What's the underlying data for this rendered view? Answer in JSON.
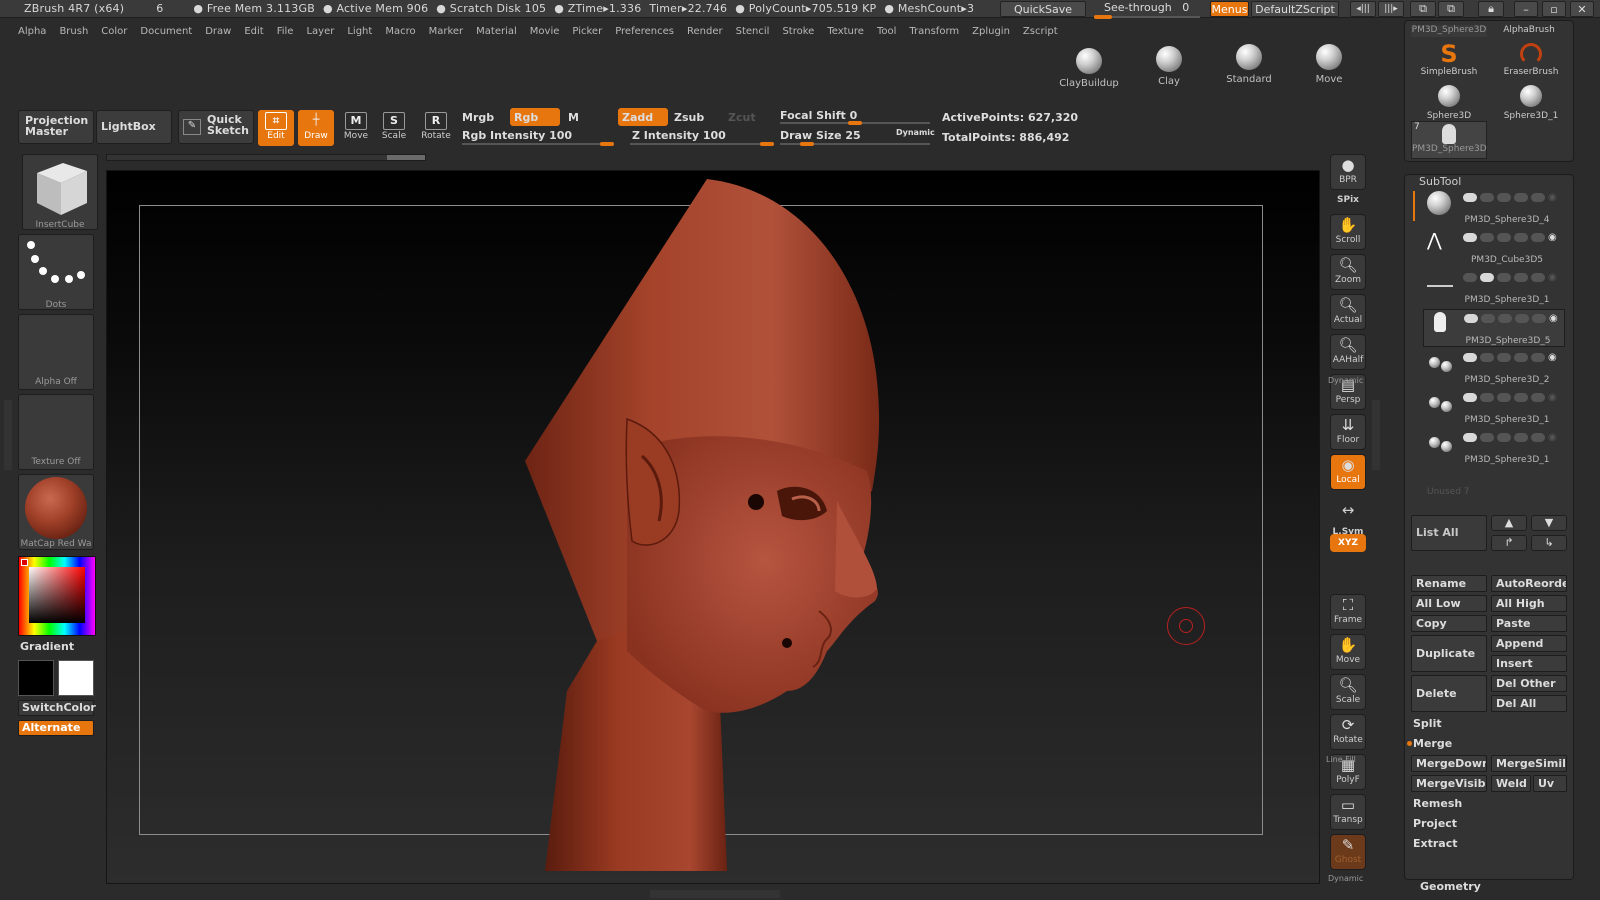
{
  "titlebar": {
    "app": "ZBrush 4R7 (x64)",
    "num": "6",
    "free_mem": "Free Mem 3.113GB",
    "active_mem": "Active Mem 906",
    "scratch": "Scratch Disk 105",
    "ztime": "ZTime▸1.336",
    "timer": "Timer▸22.746",
    "polycount": "PolyCount▸705.519 KP",
    "meshcount": "MeshCount▸3",
    "quicksave": "QuickSave",
    "seethrough": "See-through",
    "seethrough_val": "0",
    "menus": "Menus",
    "script": "DefaultZScript"
  },
  "menu": [
    "Alpha",
    "Brush",
    "Color",
    "Document",
    "Draw",
    "Edit",
    "File",
    "Layer",
    "Light",
    "Macro",
    "Marker",
    "Material",
    "Movie",
    "Picker",
    "Preferences",
    "Render",
    "Stencil",
    "Stroke",
    "Texture",
    "Tool",
    "Transform",
    "Zplugin",
    "Zscript"
  ],
  "brushes": [
    "ClayBuildup",
    "Clay",
    "Standard",
    "Move"
  ],
  "toolbar": {
    "projection_master": "Projection Master",
    "lightbox": "LightBox",
    "quick_sketch": "Quick Sketch",
    "edit": "Edit",
    "draw": "Draw",
    "move": "Move",
    "scale": "Scale",
    "rotate": "Rotate",
    "mrgb": "Mrgb",
    "rgb": "Rgb",
    "m": "M",
    "rgb_intensity": "Rgb Intensity 100",
    "zadd": "Zadd",
    "zsub": "Zsub",
    "zcut": "Zcut",
    "z_intensity": "Z Intensity 100",
    "focal_shift": "Focal Shift 0",
    "draw_size": "Draw Size 25",
    "dynamic": "Dynamic",
    "active_points": "ActivePoints: 627,320",
    "total_points": "TotalPoints: 886,492"
  },
  "leftpanel": {
    "insertcube": "InsertCube",
    "dots": "Dots",
    "alpha": "Alpha Off",
    "texture": "Texture Off",
    "matcap": "MatCap Red Wa",
    "gradient": "Gradient",
    "switchcolor": "SwitchColor",
    "alternate": "Alternate"
  },
  "rightshelf": [
    "BPR",
    "SPix",
    "Scroll",
    "Zoom",
    "Actual",
    "AAHalf",
    "Persp",
    "Floor",
    "Local",
    "L.Sym",
    "XYZ",
    "Frame",
    "Move",
    "Scale",
    "Rotate",
    "PolyF",
    "Transp",
    "Ghost"
  ],
  "rightshelf_extra": {
    "dynamic1": "Dynamic",
    "line_fill": "Line Fill",
    "dynamic2": "Dynamic"
  },
  "toolpalette": {
    "items": [
      "PM3D_Sphere3D",
      "AlphaBrush",
      "SimpleBrush",
      "EraserBrush",
      "Sphere3D",
      "Sphere3D_1",
      "PM3D_Sphere3D"
    ],
    "count": "7"
  },
  "subtool": {
    "title": "SubTool",
    "items": [
      "PM3D_Sphere3D_4",
      "PM3D_Cube3D5",
      "PM3D_Sphere3D_1",
      "PM3D_Sphere3D_5",
      "PM3D_Sphere3D_2",
      "PM3D_Sphere3D_1",
      "PM3D_Sphere3D_1"
    ],
    "unused": "Unused 7",
    "list_all": "List All",
    "buttons": {
      "rename": "Rename",
      "autoreorder": "AutoReorder",
      "all_low": "All Low",
      "all_high": "All High",
      "copy": "Copy",
      "paste": "Paste",
      "duplicate": "Duplicate",
      "append": "Append",
      "insert": "Insert",
      "delete": "Delete",
      "del_other": "Del Other",
      "del_all": "Del All",
      "split": "Split",
      "merge": "Merge",
      "mergedown": "MergeDown",
      "mergesimilar": "MergeSimilar",
      "mergevisible": "MergeVisible",
      "weld": "Weld",
      "uv": "Uv",
      "remesh": "Remesh",
      "project": "Project",
      "extract": "Extract",
      "geometry": "Geometry"
    }
  },
  "colors": {
    "accent": "#e8760f",
    "model": "#9a3a22"
  }
}
